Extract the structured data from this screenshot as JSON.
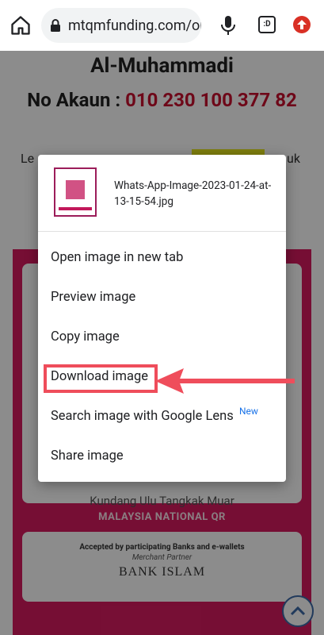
{
  "browser": {
    "url": "mtqmfunding.com/or",
    "tab_count": ":D"
  },
  "page": {
    "name": "Al-Muhammadi",
    "account_label": "No Akaun :",
    "account_number": "010 230 100 377 82",
    "lead_text_left": "Le",
    "lead_text_right": "uk",
    "address": "Kundang Ulu Tangkak Muar",
    "national_qr": "MALAYSIA NATIONAL QR",
    "accepted": "Accepted by participating Banks and e-wallets",
    "merchant_partner": "Merchant Partner",
    "bank": "BANK ISLAM"
  },
  "menu": {
    "filename": "Whats-App-Image-2023-01-24-at-13-15-54.jpg",
    "items": [
      "Open image in new tab",
      "Preview image",
      "Copy image",
      "Download image",
      "Search image with Google Lens",
      "Share image"
    ],
    "new_badge": "New"
  }
}
